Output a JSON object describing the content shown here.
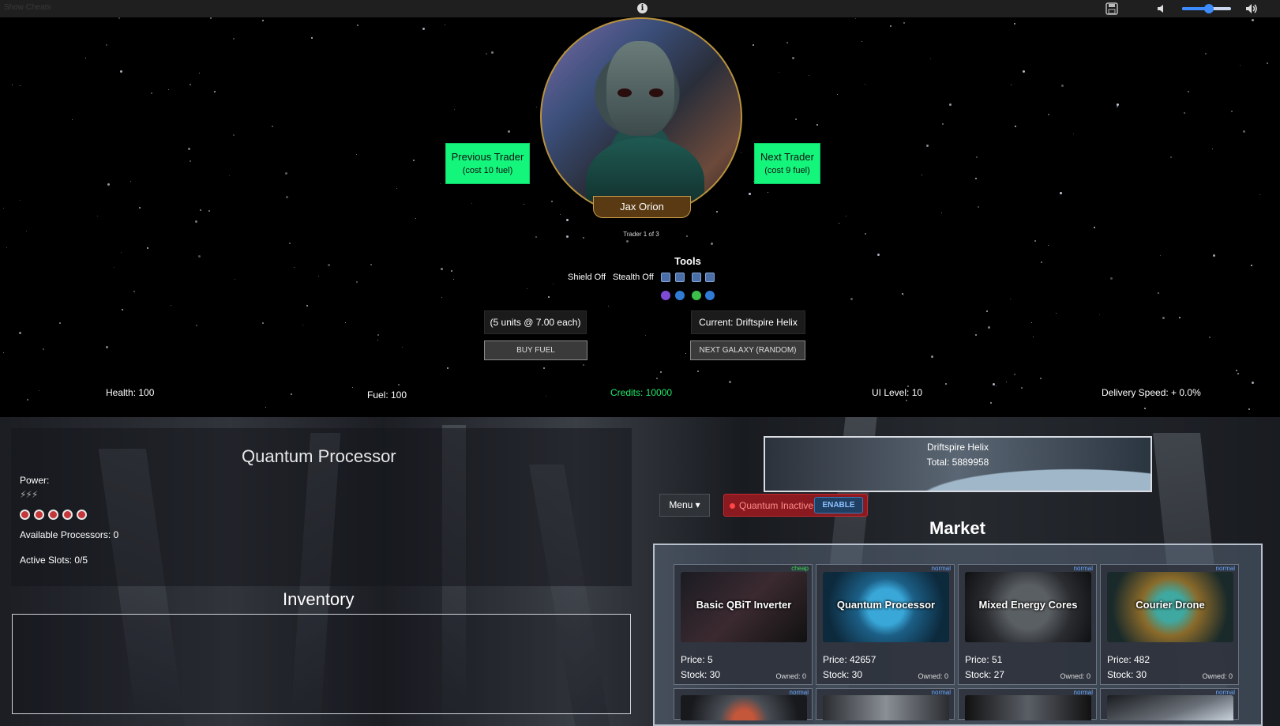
{
  "topbar": {
    "show_cheats": "Show Cheats",
    "info_glyph": "i",
    "volume_level": 0.55
  },
  "trader": {
    "name": "Jax Orion",
    "counter": "Trader 1 of 3",
    "previous": {
      "label": "Previous Trader",
      "cost": "(cost 10 fuel)"
    },
    "next": {
      "label": "Next Trader",
      "cost": "(cost 9 fuel)"
    }
  },
  "tools": {
    "title": "Tools",
    "shield": "Shield Off",
    "stealth": "Stealth Off"
  },
  "fuel": {
    "offer": "(5 units @ 7.00 each)",
    "buy_label": "BUY FUEL"
  },
  "galaxy": {
    "current": "Current: Driftspire Helix",
    "next_label": "NEXT GALAXY (RANDOM)",
    "name": "Driftspire Helix",
    "total": "Total: 5889958"
  },
  "stats": {
    "health": "Health: 100",
    "fuel": "Fuel: 100",
    "credits": "Credits: 10000",
    "ui_level": "UI Level: 10",
    "delivery_speed": "Delivery Speed: + 0.0%"
  },
  "quantum": {
    "title": "Quantum Processor",
    "power_label": "Power:",
    "bolts": "⚡⚡⚡",
    "available": "Available Processors: 0",
    "active_slots": "Active Slots: 0/5",
    "status": "Quantum Inactive",
    "enable_label": "ENABLE"
  },
  "inventory": {
    "title": "Inventory"
  },
  "menu": {
    "label": "Menu ▾"
  },
  "market": {
    "title": "Market",
    "items": [
      {
        "name": "Basic QBiT Inverter",
        "price": "Price: 5",
        "stock": "Stock: 30",
        "owned": "Owned: 0",
        "tag": "cheap"
      },
      {
        "name": "Quantum Processor",
        "price": "Price: 42657",
        "stock": "Stock: 30",
        "owned": "Owned: 0",
        "tag": "normal"
      },
      {
        "name": "Mixed Energy Cores",
        "price": "Price: 51",
        "stock": "Stock: 27",
        "owned": "Owned: 0",
        "tag": "normal"
      },
      {
        "name": "Courier Drone",
        "price": "Price: 482",
        "stock": "Stock: 30",
        "owned": "Owned: 0",
        "tag": "normal"
      }
    ],
    "row2_tags": [
      "normal",
      "normal",
      "normal",
      "normal"
    ]
  },
  "colors": {
    "nav_button": "#14f57b",
    "credits": "#20e86a",
    "quantum_inactive": "#8a1a1f",
    "tag_cheap": "#3ddc55",
    "tag_normal": "#6aa8ff"
  }
}
